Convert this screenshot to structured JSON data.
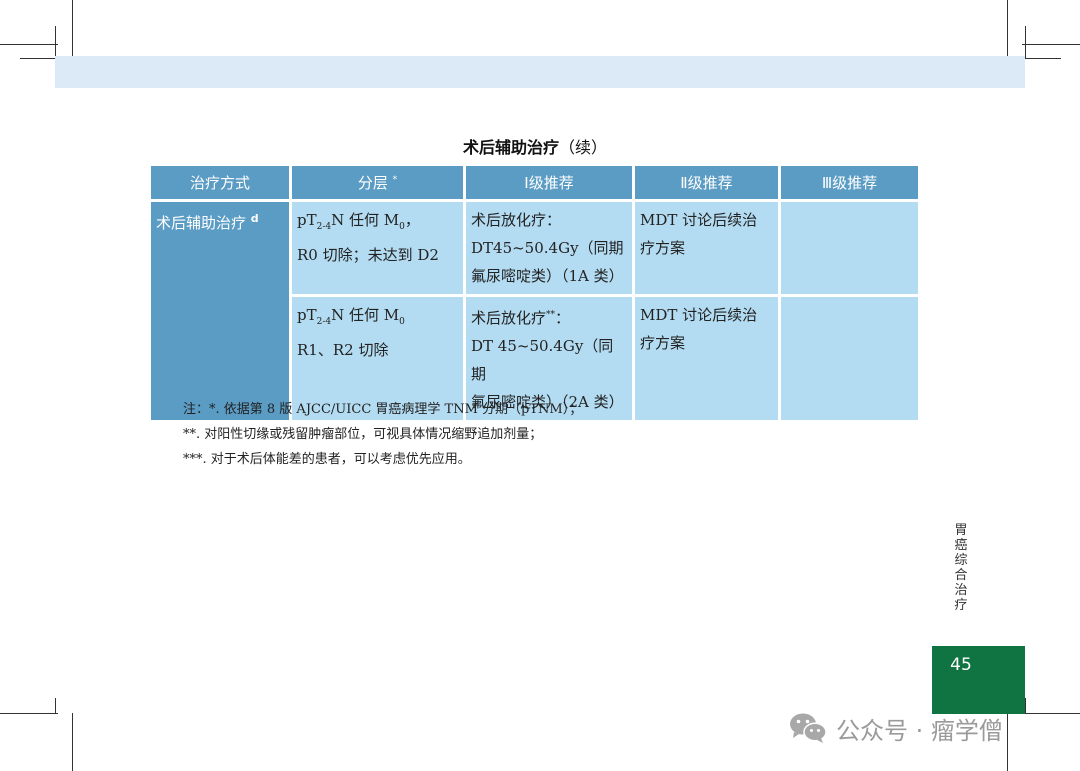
{
  "table_title": "术后辅助治疗",
  "table_title_suffix": "（续）",
  "headers": {
    "modality": "治疗方式",
    "stage": "分层",
    "stage_mark": "*",
    "level1": "Ⅰ级推荐",
    "level2": "Ⅱ级推荐",
    "level3": "Ⅲ级推荐"
  },
  "modality": {
    "label": "术后辅助治疗",
    "mark": "d"
  },
  "rows": [
    {
      "stage_p": "p",
      "stage_T": "T",
      "stage_sub1": "2-4",
      "stage_N": "N 任何 M",
      "stage_sub2": "0",
      "stage_end": "，",
      "stage_line2": "R0 切除；未达到 D2",
      "level1_line1": "术后放化疗：",
      "level1_mark": "",
      "level1_line2": "DT45~50.4Gy（同期",
      "level1_line3": "氟尿嘧啶类）（1A 类）",
      "level2_line1": "MDT 讨论后续治",
      "level2_line2": "疗方案",
      "level3": ""
    },
    {
      "stage_p": "p",
      "stage_T": "T",
      "stage_sub1": "2-4",
      "stage_N": "N 任何 M",
      "stage_sub2": "0",
      "stage_end": "",
      "stage_line2": "R1、R2 切除",
      "level1_line1": "术后放化疗",
      "level1_mark": "**",
      "level1_line1_end": "：",
      "level1_line2": "DT 45~50.4Gy（同期",
      "level1_line3": "氟尿嘧啶类）（2A 类）",
      "level2_line1": "MDT 讨论后续治",
      "level2_line2": "疗方案",
      "level3": ""
    }
  ],
  "notes": [
    "注：*. 依据第 8 版 AJCC/UICC 胃癌病理学 TNM 分期（pTNM）；",
    "**. 对阳性切缘或残留肿瘤部位，可视具体情况缩野追加剂量；",
    "***. 对于术后体能差的患者，可以考虑优先应用。"
  ],
  "side_label": "胃癌综合治疗",
  "page_number": "45",
  "watermark": "公众号 · 瘤学僧",
  "colors": {
    "header_bg": "#5b9cc4",
    "cell_bg": "#b3dcf2",
    "band": "#dbeaf6",
    "page_box": "#0f7442"
  }
}
